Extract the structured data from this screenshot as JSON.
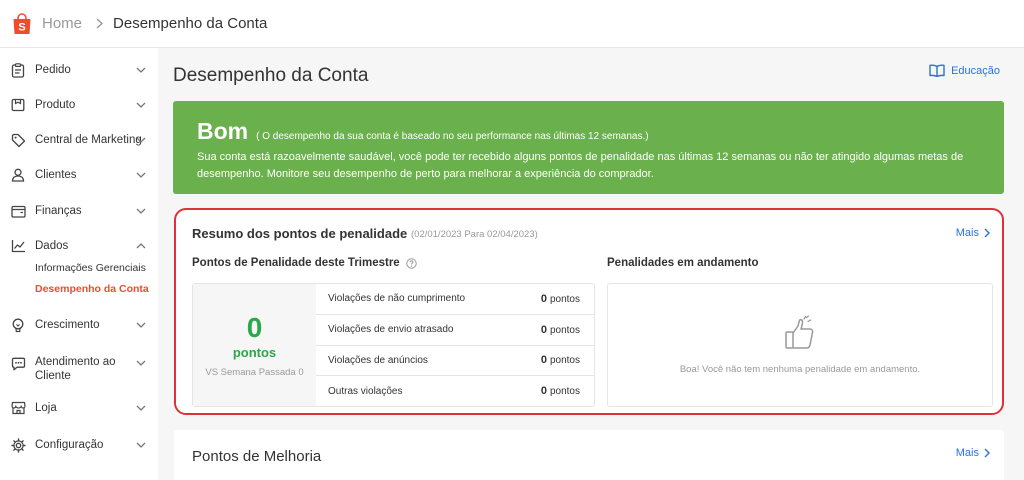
{
  "header": {
    "breadcrumb_home": "Home",
    "breadcrumb_current": "Desempenho da Conta"
  },
  "sidebar": {
    "items": [
      {
        "label": "Pedido",
        "icon": "clipboard-icon"
      },
      {
        "label": "Produto",
        "icon": "box-icon"
      },
      {
        "label": "Central de Marketing",
        "icon": "tag-icon"
      },
      {
        "label": "Clientes",
        "icon": "user-icon"
      },
      {
        "label": "Finanças",
        "icon": "wallet-icon"
      },
      {
        "label": "Dados",
        "icon": "chart-icon",
        "expanded": true
      },
      {
        "label": "Crescimento",
        "icon": "lightbulb-icon"
      },
      {
        "label": "Atendimento ao Cliente",
        "icon": "chat-icon"
      },
      {
        "label": "Loja",
        "icon": "store-icon"
      },
      {
        "label": "Configuração",
        "icon": "gear-icon"
      }
    ],
    "dados_sub": [
      "Informações Gerenciais",
      "Desempenho da Conta"
    ],
    "active_sub": "Desempenho da Conta"
  },
  "main": {
    "title": "Desempenho da Conta",
    "edu_label": "Educação",
    "banner": {
      "grade": "Bom",
      "note": "( O desempenho da sua conta é baseado no seu performance nas últimas 12 semanas.)",
      "desc": "Sua conta está razoavelmente saudável, você pode ter recebido alguns pontos de penalidade nas últimas 12 semanas ou não ter atingido algumas metas de desempenho. Monitore seu desempenho de perto para melhorar a experiência do comprador."
    },
    "penalty": {
      "title": "Resumo dos pontos de penalidade",
      "range": "(02/01/2023 Para 02/04/2023)",
      "more": "Mais",
      "quarter_title": "Pontos de Penalidade deste Trimestre",
      "points": "0",
      "points_unit": "pontos",
      "vs_label": "VS Semana Passada 0",
      "violations": [
        {
          "label": "Violações de não cumprimento",
          "value": "0",
          "unit": "pontos"
        },
        {
          "label": "Violações de envio atrasado",
          "value": "0",
          "unit": "pontos"
        },
        {
          "label": "Violações de anúncios",
          "value": "0",
          "unit": "pontos"
        },
        {
          "label": "Outras violações",
          "value": "0",
          "unit": "pontos"
        }
      ],
      "pending_title": "Penalidades em andamento",
      "pending_empty": "Boa! Você não tem nenhuma penalidade em andamento."
    },
    "improvement": {
      "title": "Pontos de Melhoria",
      "more": "Mais"
    }
  },
  "colors": {
    "brand": "#ee4d2d",
    "banner_green": "#6ab04c",
    "link_blue": "#2673dd",
    "points_green": "#2aa84a",
    "highlight_red": "#e0303a"
  }
}
